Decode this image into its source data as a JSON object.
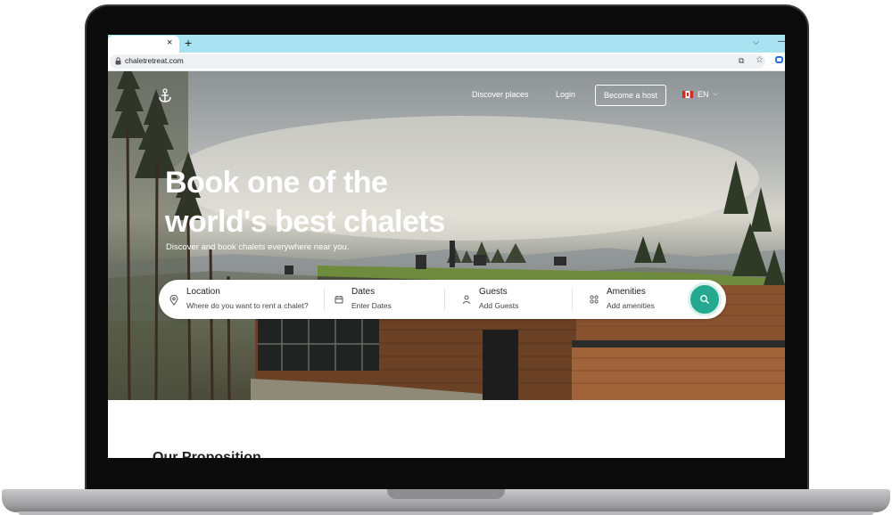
{
  "browser": {
    "tab_close": "×",
    "new_tab": "+",
    "tab_menu": "⌵",
    "minimize": "—",
    "url": "chaletretreat.com"
  },
  "nav": {
    "discover": "Discover places",
    "login": "Login",
    "become_host": "Become a host",
    "language": "EN"
  },
  "hero": {
    "title_line1": "Book one of the",
    "title_line2": "world's best chalets",
    "subtitle": "Discover and book chalets everywhere near you."
  },
  "search": {
    "location_label": "Location",
    "location_placeholder": "Where do you want to rent a chalet?",
    "dates_label": "Dates",
    "dates_placeholder": "Enter Dates",
    "guests_label": "Guests",
    "guests_placeholder": "Add Guests",
    "amenities_label": "Amenities",
    "amenities_placeholder": "Add amenities"
  },
  "section": {
    "heading_partial": "Our Proposition"
  },
  "colors": {
    "accent": "#24a890",
    "tabstrip": "#a9e3f1"
  },
  "icons": [
    "anchor-logo-icon",
    "location-pin-icon",
    "calendar-icon",
    "person-icon",
    "grid-icon",
    "search-icon",
    "lock-icon",
    "star-icon",
    "translate-icon",
    "canada-flag-icon"
  ]
}
